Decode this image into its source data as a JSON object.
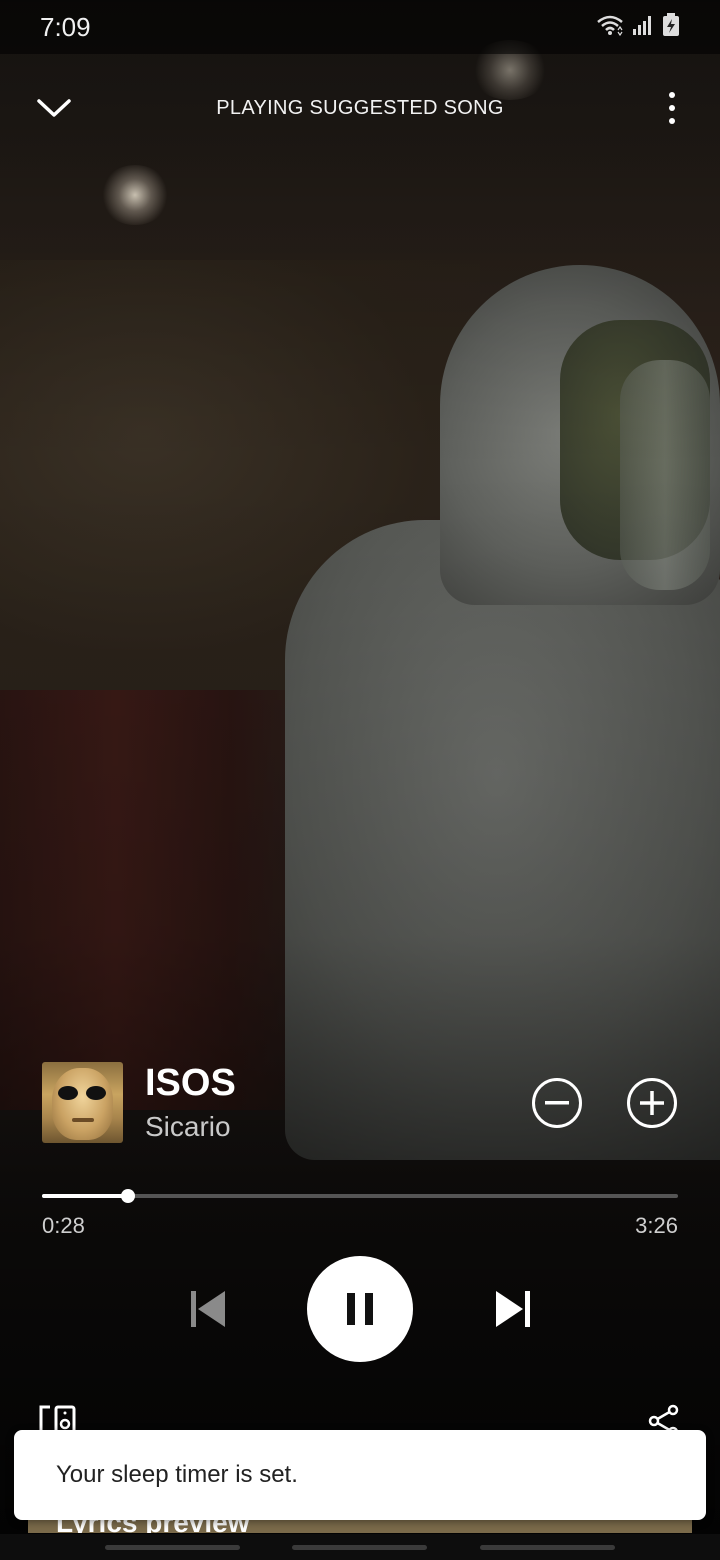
{
  "status_bar": {
    "time": "7:09",
    "icons": [
      "wifi-icon",
      "signal-icon",
      "battery-charging-icon"
    ]
  },
  "header": {
    "title": "PLAYING SUGGESTED SONG",
    "collapse_icon": "chevron-down-icon",
    "menu_icon": "more-vertical-icon"
  },
  "track": {
    "title": "ISOS",
    "artist": "Sicario",
    "remove_icon": "minus-circle-icon",
    "add_icon": "plus-circle-icon"
  },
  "playback": {
    "position": "0:28",
    "duration": "3:26",
    "progress_fraction": 0.136,
    "state": "playing",
    "controls": [
      "previous-icon",
      "pause-icon",
      "next-icon"
    ]
  },
  "bottom_actions": {
    "devices_icon": "connect-devices-icon",
    "share_icon": "share-icon"
  },
  "lyrics": {
    "label": "Lyrics preview"
  },
  "snackbar": {
    "message": "Your sleep timer is set."
  },
  "colors": {
    "lyrics_bg": "#7a6a4a",
    "snackbar_bg": "#ffffff",
    "accent": "#ffffff"
  }
}
